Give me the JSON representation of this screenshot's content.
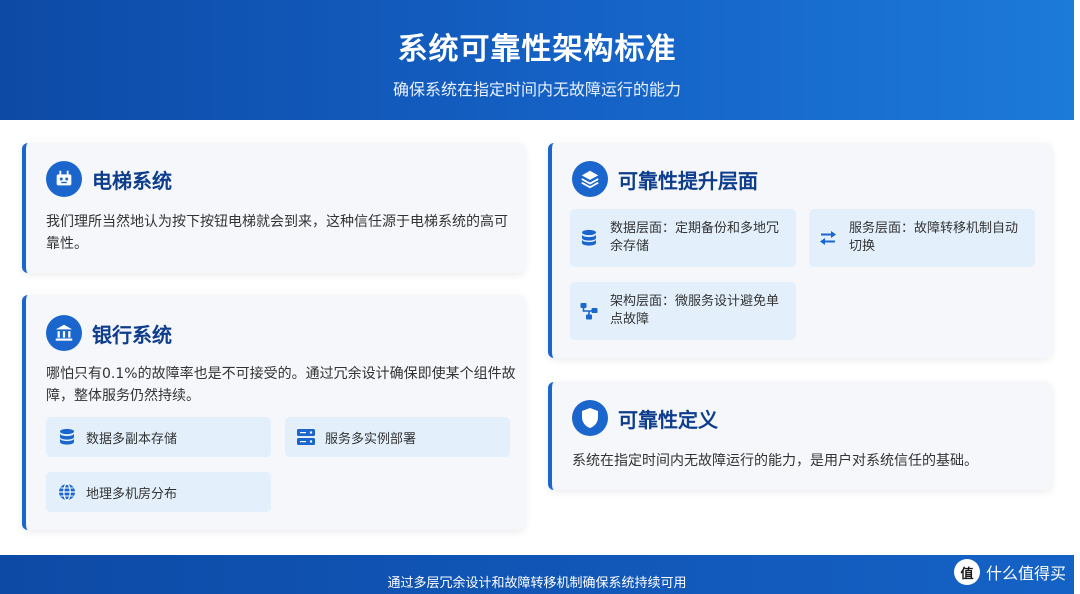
{
  "header": {
    "title": "系统可靠性架构标准",
    "subtitle": "确保系统在指定时间内无故障运行的能力"
  },
  "elevator_card": {
    "icon": "robot-icon",
    "title": "电梯系统",
    "text": "我们理所当然地认为按下按钮电梯就会到来，这种信任源于电梯系统的高可靠性。"
  },
  "bank_card": {
    "icon": "bank-icon",
    "title": "银行系统",
    "text": "哪怕只有0.1%的故障率也是不可接受的。通过冗余设计确保即使某个组件故障，整体服务仍然持续。",
    "tags": [
      {
        "icon": "database-icon",
        "label": "数据多副本存储"
      },
      {
        "icon": "server-icon",
        "label": "服务多实例部署"
      },
      {
        "icon": "globe-icon",
        "label": "地理多机房分布"
      }
    ]
  },
  "levels_card": {
    "icon": "layers-icon",
    "title": "可靠性提升层面",
    "tags": [
      {
        "icon": "database-icon",
        "label": "数据层面：定期备份和多地冗余存储"
      },
      {
        "icon": "swap-arrows-icon",
        "label": "服务层面：故障转移机制自动切换"
      },
      {
        "icon": "topology-icon",
        "label": "架构层面：微服务设计避免单点故障"
      }
    ]
  },
  "definition_card": {
    "icon": "shield-icon",
    "title": "可靠性定义",
    "text": "系统在指定时间内无故障运行的能力，是用户对系统信任的基础。"
  },
  "footer": {
    "text": "通过多层冗余设计和故障转移机制确保系统持续可用"
  },
  "watermark": {
    "label": "什么值得买",
    "logo_glyph": "值"
  },
  "colors": {
    "accent": "#1a66cc",
    "title_dark": "#0d3d8c",
    "tag_bg": "#e3f0fc",
    "card_bg": "#f5f7fa"
  }
}
